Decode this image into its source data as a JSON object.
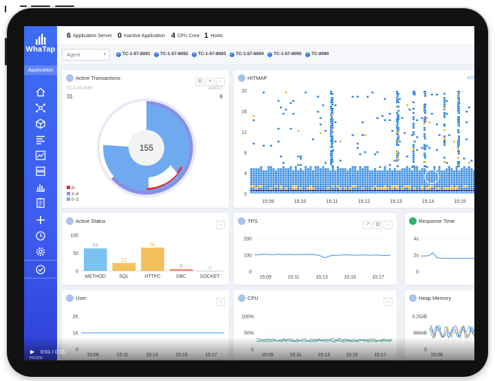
{
  "sidebar": {
    "brand": "WhaTap",
    "section": "Application"
  },
  "topbar": {
    "stats": [
      {
        "value": "6",
        "label": "Application Server"
      },
      {
        "value": "0",
        "label": "Inactive Application"
      },
      {
        "value": "4",
        "label": "CPU Core"
      },
      {
        "value": "1",
        "label": "Hosts"
      }
    ]
  },
  "filter": {
    "select_value": "Agent",
    "agents": [
      "TC-1-57-8091",
      "TC-1-57-8092",
      "TC-1-57-8093",
      "TC-1-57-8094",
      "TC-1-57-8095",
      "TC-8090"
    ]
  },
  "active_tx": {
    "title": "Active Transactions",
    "agent_name": "TC-1-57-8095",
    "agent_label": "AGENT",
    "left_count": "31",
    "right_count": "6",
    "center": "155",
    "legend": [
      "8~",
      "3~8",
      "0~3"
    ],
    "legend_colors": [
      "#e0303a",
      "#8a8fe6",
      "#6faaf0"
    ]
  },
  "hitmap": {
    "title": "HITMAP",
    "corner": "623",
    "y_ticks": [
      "20",
      "16",
      "12",
      "8",
      "4",
      "0"
    ],
    "x_ticks": [
      "15:09",
      "15:10",
      "15:11",
      "15:12",
      "15:13",
      "15:14",
      "15:15"
    ]
  },
  "active_status": {
    "title": "Active Status",
    "chart_data": {
      "type": "bar",
      "categories": [
        "METHOD",
        "SQL",
        "HTTPC",
        "DBC",
        "SOCKET"
      ],
      "values": [
        63,
        22,
        65,
        5,
        0
      ],
      "ylim": [
        0,
        100
      ],
      "y_ticks": [
        "100",
        "50",
        "0"
      ],
      "colors": [
        "#5fb6ef",
        "#f0b33c",
        "#f0b33c",
        "#ef6a5a",
        "#bdbdbd"
      ]
    }
  },
  "tps": {
    "title": "TPS",
    "chart_data": {
      "type": "line",
      "x": [
        "15:09",
        "15:11",
        "15:13",
        "15:15",
        "15:17"
      ],
      "y_ticks": [
        "200",
        "100",
        "0"
      ],
      "ylim": [
        0,
        200
      ],
      "values": [
        102,
        103,
        104,
        106,
        105,
        104,
        103,
        104,
        106,
        105,
        103,
        104,
        105,
        104,
        103,
        104,
        103,
        104,
        105,
        104,
        103,
        102,
        98,
        90,
        84,
        92,
        97,
        100,
        99,
        100,
        101,
        102,
        101,
        100,
        99,
        101,
        100,
        102,
        101,
        99,
        100,
        101,
        100,
        99,
        98,
        99,
        100
      ]
    }
  },
  "response_time": {
    "title": "Response Time",
    "chart_data": {
      "type": "line",
      "y_ticks": [
        "4s",
        "2s",
        "0"
      ],
      "ylim": [
        0,
        4
      ],
      "values": [
        1.9,
        1.9,
        1.95,
        2.3,
        1.7,
        1.65,
        1.62,
        1.6,
        1.61,
        1.6,
        1.62,
        1.63,
        1.6,
        1.61,
        1.6,
        1.6
      ]
    }
  },
  "user": {
    "title": "User",
    "chart_data": {
      "type": "line",
      "y_ticks": [
        "2K",
        "1K",
        "0"
      ],
      "ylim": [
        0,
        2000
      ],
      "x": [
        "15:09",
        "15:11",
        "15:13",
        "15:15",
        "15:17"
      ],
      "values": [
        1000,
        1000
      ]
    }
  },
  "cpu": {
    "title": "CPU",
    "chart_data": {
      "type": "line",
      "y_ticks": [
        "100%",
        "50%",
        "0"
      ],
      "ylim": [
        0,
        100
      ],
      "x": [
        "15:09",
        "15:11",
        "15:13",
        "15:15",
        "15:17"
      ]
    }
  },
  "heap": {
    "title": "Heap Memory",
    "chart_data": {
      "type": "line",
      "y_ticks": [
        "0.2GiB",
        "98MiB",
        "0"
      ],
      "x": [
        "15:09"
      ]
    }
  },
  "video": {
    "time": "0:01 / 0:15",
    "sub": "PICODE"
  },
  "colors": {
    "accent": "#3d5df0",
    "hitmap_blue": "#2f86dd",
    "hitmap_yellow": "#f0b33c",
    "hitmap_navy": "#1a2a7a"
  }
}
